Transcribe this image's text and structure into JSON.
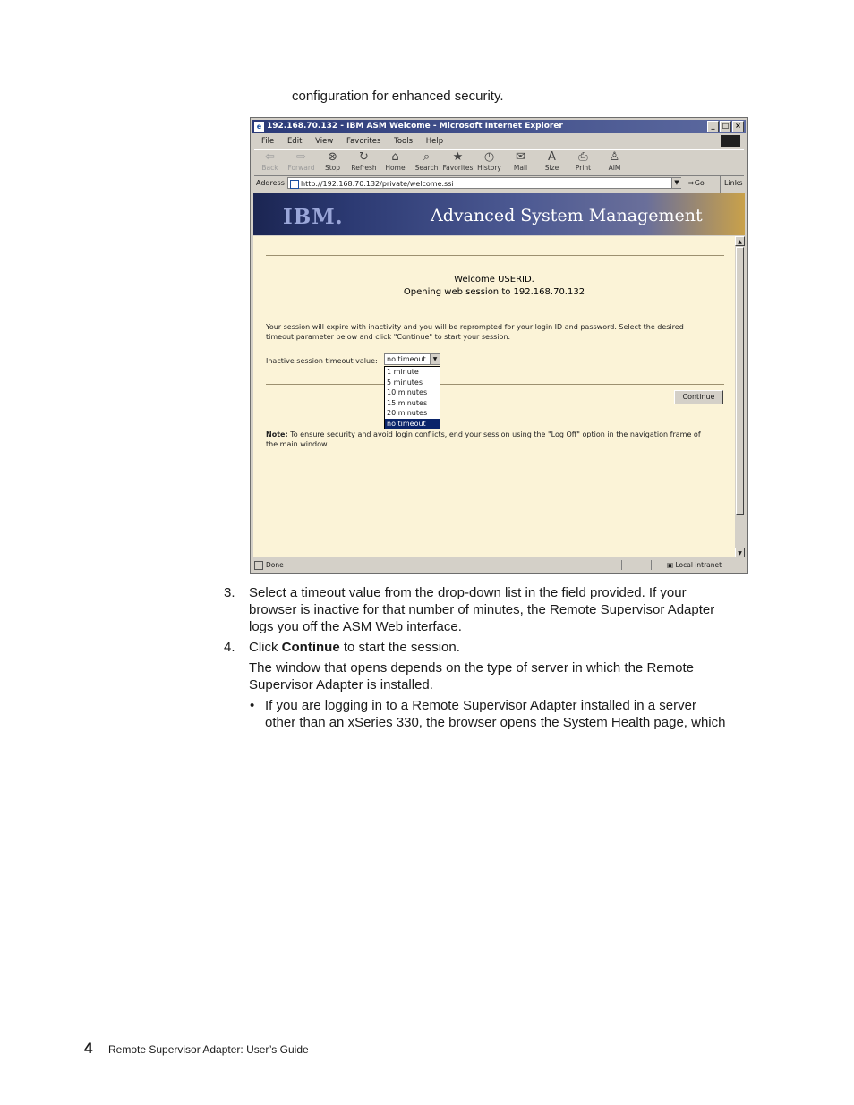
{
  "intro_text": "configuration for enhanced security.",
  "browser": {
    "title": "192.168.70.132 - IBM ASM Welcome - Microsoft Internet Explorer",
    "menu": [
      "File",
      "Edit",
      "View",
      "Favorites",
      "Tools",
      "Help"
    ],
    "toolbar": [
      "Back",
      "Forward",
      "Stop",
      "Refresh",
      "Home",
      "Search",
      "Favorites",
      "History",
      "Mail",
      "Size",
      "Print",
      "AIM"
    ],
    "address_label": "Address",
    "address_value": "http://192.168.70.132/private/welcome.ssi",
    "go_label": "Go",
    "links_label": "Links",
    "status_left": "Done",
    "status_zone": "Local intranet"
  },
  "page": {
    "logo": "IBM.",
    "banner_title": "Advanced System Management",
    "welcome_line1": "Welcome USERID.",
    "welcome_line2": "Opening web session to 192.168.70.132",
    "session_text_1": "Your session will expire with inactivity and you will be reprompted for your login ID and password. Select the desired",
    "session_text_2": "timeout parameter below and click \"Continue\" to start your session.",
    "timeout_label": "Inactive session timeout value:",
    "timeout_selected": "no timeout",
    "timeout_options": [
      "1 minute",
      "5 minutes",
      "10 minutes",
      "15 minutes",
      "20 minutes",
      "no timeout"
    ],
    "continue_label": "Continue",
    "note_label": "Note:",
    "note_text_1": "To ensure security and avoid login conflicts, end your session using the \"Log Off\" option in the navigation frame of",
    "note_text_2": "the main window."
  },
  "steps": {
    "s3_num": "3.",
    "s3_line1": "Select a timeout value from the drop-down list in the field provided. If your",
    "s3_line2": "browser is inactive for that number of minutes, the Remote Supervisor Adapter",
    "s3_line3": "logs you off the ASM Web interface.",
    "s4_num": "4.",
    "s4_pre": "Click ",
    "s4_bold": "Continue",
    "s4_post": " to start the session.",
    "para_line1": "The window that opens depends on the type of server in which the Remote",
    "para_line2": "Supervisor Adapter is installed.",
    "bullet_mark": "•",
    "bullet_line1": "If you are logging in to a Remote Supervisor Adapter installed in a server",
    "bullet_line2": "other than an xSeries 330, the browser opens the System Health page, which"
  },
  "footer": {
    "page_number": "4",
    "title": "Remote Supervisor Adapter: User’s Guide"
  }
}
